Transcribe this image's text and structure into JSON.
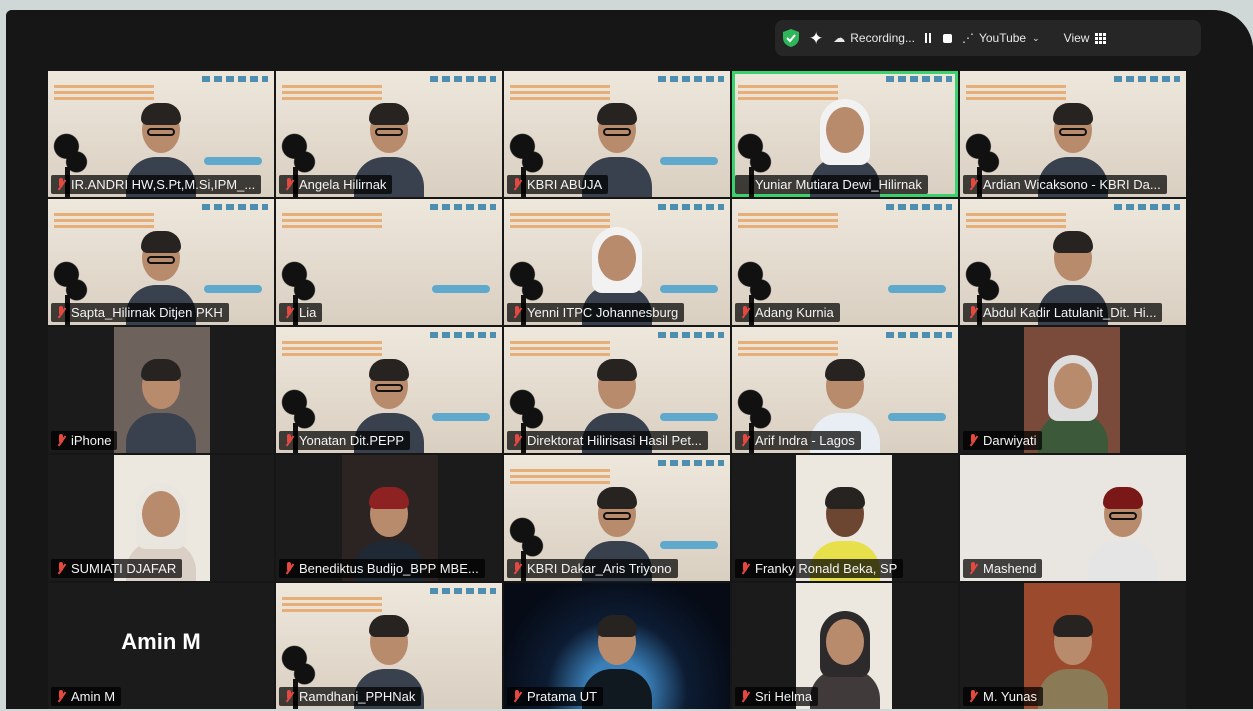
{
  "toolbar": {
    "recording_label": "Recording...",
    "stream_label": "YouTube",
    "view_label": "View",
    "icons": [
      "shield-check-icon",
      "sparkle-icon",
      "cloud-record-icon",
      "pause-icon",
      "stop-icon",
      "broadcast-icon",
      "chevron-down-icon",
      "grid-view-icon"
    ],
    "colors": {
      "shield": "#2fb55a",
      "speaking_border": "#3bd16f",
      "muted_mic": "#e5483f"
    }
  },
  "participants": [
    "IR.ANDRI HW,S.Pt,M.Si,IPM_...",
    "Angela Hilirnak",
    "KBRI ABUJA",
    "Yuniar Mutiara Dewi_Hilirnak",
    "Ardian Wicaksono - KBRI Da...",
    "Sapta_Hilirnak Ditjen PKH",
    "Lia",
    "Yenni ITPC Johannesburg",
    "Adang Kurnia",
    "Abdul Kadir Latulanit_Dit. Hi...",
    "iPhone",
    "Yonatan Dit.PEPP",
    "Direktorat Hilirisasi Hasil Pet...",
    "Arif Indra - Lagos",
    "Darwiyati",
    "SUMIATI DJAFAR",
    "Benediktus Budijo_BPP MBE...",
    "KBRI Dakar_Aris Triyono",
    "Franky Ronald Beka, SP",
    "Mashend",
    "Amin M",
    "Ramdhani_PPHNak",
    "Pratama UT",
    "Sri Helma",
    "M. Yunas"
  ],
  "avatar_text": {
    "t20": "Amin M"
  }
}
